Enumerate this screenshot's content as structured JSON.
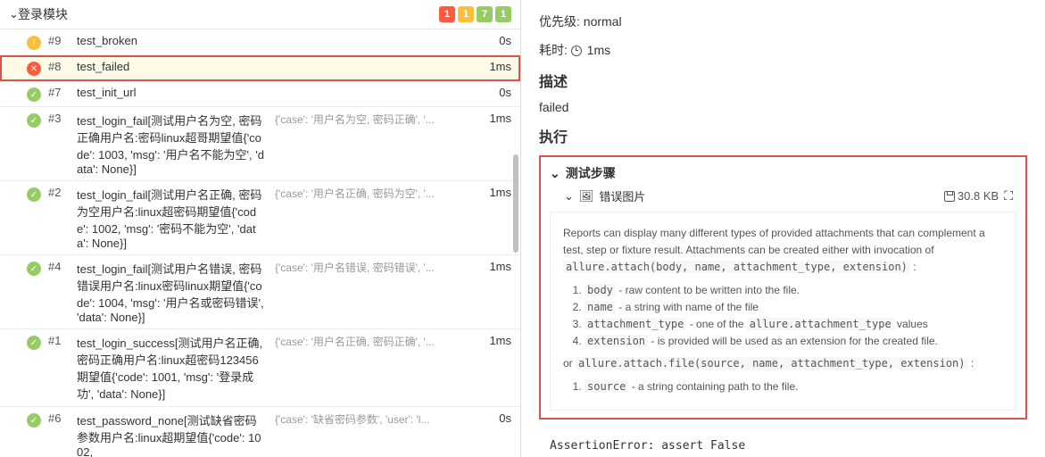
{
  "left": {
    "title": "登录模块",
    "badges": {
      "red": "1",
      "yellow": "1",
      "green": "7",
      "extra": "1"
    },
    "items": [
      {
        "status": "broken",
        "num": "#9",
        "name": "test_broken",
        "param": "",
        "dur": "0s"
      },
      {
        "status": "fail",
        "num": "#8",
        "name": "test_failed",
        "param": "",
        "dur": "1ms",
        "selected": true
      },
      {
        "status": "pass",
        "num": "#7",
        "name": "test_init_url",
        "param": "",
        "dur": "0s"
      },
      {
        "status": "pass",
        "num": "#3",
        "name": "test_login_fail[测试用户名为空, 密码正确用户名:密码linux超哥期望值{'code': 1003, 'msg': '用户名不能为空', 'data': None}]",
        "param": "{'case': '用户名为空, 密码正确', '...",
        "dur": "1ms"
      },
      {
        "status": "pass",
        "num": "#2",
        "name": "test_login_fail[测试用户名正确, 密码为空用户名:linux超密码期望值{'code': 1002, 'msg': '密码不能为空', 'data': None}]",
        "param": "{'case': '用户名正确, 密码为空', '...",
        "dur": "1ms"
      },
      {
        "status": "pass",
        "num": "#4",
        "name": "test_login_fail[测试用户名错误, 密码错误用户名:linux密码linux期望值{'code': 1004, 'msg': '用户名或密码错误', 'data': None}]",
        "param": "{'case': '用户名错误, 密码错误', '...",
        "dur": "1ms"
      },
      {
        "status": "pass",
        "num": "#1",
        "name": "test_login_success[测试用户名正确, 密码正确用户名:linux超密码123456期望值{'code': 1001, 'msg': '登录成功', 'data': None}]",
        "param": "{'case': '用户名正确, 密码正确', '...",
        "dur": "1ms"
      },
      {
        "status": "pass",
        "num": "#6",
        "name": "test_password_none[测试缺省密码参数用户名:linux超期望值{'code': 1002,",
        "param": "{'case': '缺省密码参数', 'user': 'l...",
        "dur": "0s"
      }
    ]
  },
  "right": {
    "priority_label": "优先级:",
    "priority_value": "normal",
    "time_label": "耗时:",
    "time_value": "1ms",
    "desc_heading": "描述",
    "desc_value": "failed",
    "exec_heading": "执行",
    "steps_heading": "测试步骤",
    "attach_name": "错误图片",
    "attach_size": "30.8 KB",
    "doc": {
      "intro": "Reports can display many different types of provided attachments that can complement a test, step or fixture result. Attachments can be created either with invocation of ",
      "intro_code": "allure.attach(body, name, attachment_type, extension)",
      "li1_code": "body",
      "li1": " - raw content to be written into the file.",
      "li2_code": "name",
      "li2": " - a string with name of the file",
      "li3_code": "attachment_type",
      "li3": " - one of the ",
      "li3_code2": "allure.attachment_type",
      "li3b": " values",
      "li4_code": "extension",
      "li4": " - is provided will be used as an extension for the created file.",
      "or": "or ",
      "or_code": "allure.attach.file(source, name, attachment_type, extension)",
      "or2": " :",
      "li5_code": "source",
      "li5": " - a string containing path to the file."
    },
    "error": "AssertionError: assert False"
  }
}
